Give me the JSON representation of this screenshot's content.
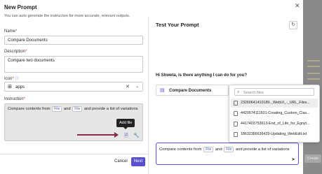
{
  "dialog": {
    "title": "New Prompt",
    "hint": "You can auto generate the instruction for more accurate, relevant outputs."
  },
  "form": {
    "name_label": "Name",
    "name_value": "Compare Documents",
    "description_label": "Description",
    "description_value": "Compare two documents",
    "icon_label": "Icon",
    "icon_value": "apps",
    "instruction_label": "Instruction",
    "instruction_parts": [
      "Compare contents from",
      "File",
      "and",
      "File",
      "and provide a list of variations"
    ],
    "tooltip": "Add file"
  },
  "footer": {
    "cancel_label": "Cancel",
    "next_label": "Next"
  },
  "test_panel": {
    "title": "Test Your Prompt",
    "greeting": "Hi Shweta, is there anything I can do for you?",
    "card_label": "Compare Documents",
    "search_placeholder": "Search files",
    "files": [
      "23260641410189-_WebUI_-_URL_Files...",
      "4420574111501-Creating_Custom_Clas...",
      "4417403753613-End_of_Life_for_Egnyt...",
      "18632386636429-Updating_WebEdit.txt"
    ],
    "input_parts": [
      "Compare contents from",
      "File",
      "and",
      "File",
      "and provide a list of variations"
    ]
  },
  "background": {
    "create_label": "Create"
  },
  "colors": {
    "accent": "#5a4fcf",
    "arrow": "#8b2a4a"
  }
}
